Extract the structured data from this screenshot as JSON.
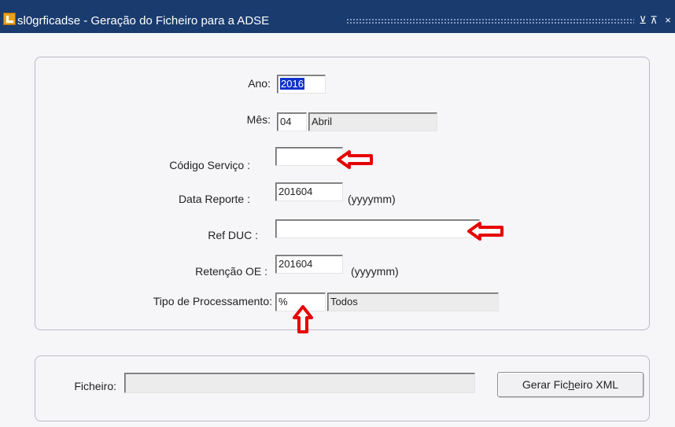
{
  "window": {
    "title": "sl0grficadse - Geração do Ficheiro para a ADSE",
    "controls": {
      "minimize": "⊻",
      "restore": "⊼",
      "close": "×"
    }
  },
  "form": {
    "ano": {
      "label": "Ano:",
      "value": "2016"
    },
    "mes": {
      "label": "Mês:",
      "value": "04",
      "description": "Abril"
    },
    "codigo_servico": {
      "label": "Código Serviço :",
      "value": ""
    },
    "data_reporte": {
      "label": "Data Reporte :",
      "value": "201604",
      "hint": "(yyyymm)"
    },
    "ref_duc": {
      "label": "Ref DUC :",
      "value": ""
    },
    "retencao_oe": {
      "label": "Retenção OE :",
      "value": "201604",
      "hint": "(yyyymm)"
    },
    "tipo_processamento": {
      "label": "Tipo de Processamento:",
      "value": "%",
      "description": "Todos"
    }
  },
  "file_section": {
    "label": "Ficheiro:",
    "value": "",
    "button": {
      "before": "Gerar Fic",
      "underlined": "h",
      "after": "eiro XML"
    }
  },
  "annotation_color": "#e60000"
}
